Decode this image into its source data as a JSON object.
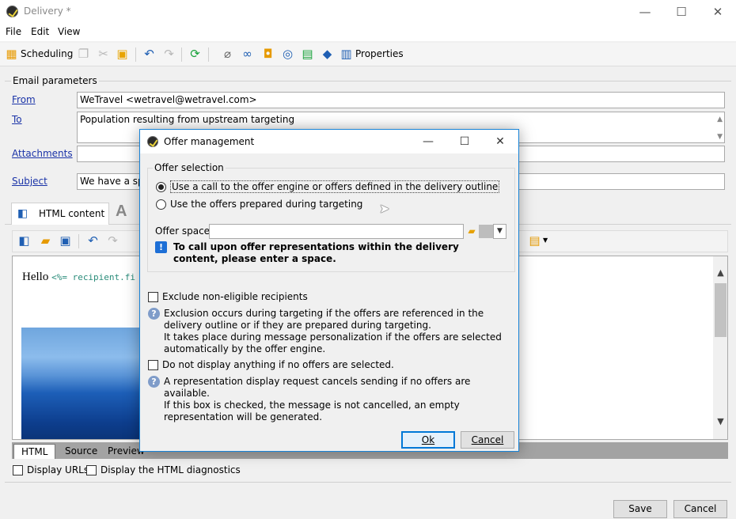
{
  "window": {
    "title": "Delivery *",
    "minimize_glyph": "—",
    "maximize_glyph": "☐",
    "close_glyph": "✕"
  },
  "menu": [
    "File",
    "Edit",
    "View"
  ],
  "toolbar": {
    "scheduling_label": "Scheduling",
    "properties_label": "Properties",
    "icons": [
      "calendar-icon",
      "copy-icon",
      "cut-icon",
      "paste-icon",
      "undo-icon",
      "redo-icon",
      "refresh-icon",
      "attachment-icon",
      "link-icon",
      "gift-icon",
      "target-icon",
      "calculator-icon",
      "tag-icon",
      "clipboard-icon"
    ]
  },
  "email_params": {
    "legend": "Email parameters",
    "from_label": "From",
    "from_value": "WeTravel <wetravel@wetravel.com>",
    "to_label": "To",
    "to_value": "Population resulting from upstream targeting",
    "attachments_label": "Attachments",
    "attachments_value": "",
    "subject_label": "Subject",
    "subject_value": "We have a spe"
  },
  "content_tabs": {
    "html_content": "HTML content",
    "text_tab_glyph": "A"
  },
  "editor": {
    "hello_text": "Hello",
    "hello_code": "<%= recipient.fi"
  },
  "bottom_tabs": [
    "HTML",
    "Source",
    "Preview"
  ],
  "options": {
    "display_urls": "Display URLs",
    "display_html_diagnostics": "Display the HTML diagnostics"
  },
  "footer": {
    "save": "Save",
    "cancel": "Cancel"
  },
  "dialog": {
    "title": "Offer management",
    "offer_selection_legend": "Offer selection",
    "radio_offer_engine": "Use a call to the offer engine or offers defined in the delivery outline",
    "radio_prepared": "Use the offers prepared during targeting",
    "offer_space_label": "Offer space:",
    "offer_space_value": "",
    "offer_space_info": "To call upon offer representations within the delivery content, please enter a space.",
    "exclude_label": "Exclude non-eligible recipients",
    "exclude_help": "Exclusion occurs during targeting if the offers are referenced in the delivery outline or if they are prepared during targeting.\nIt takes place during message personalization if the offers are selected automatically by the offer engine.",
    "no_display_label": "Do not display anything if no offers are selected.",
    "no_display_help": "A representation display request cancels sending if no offers are available.\nIf this box is checked, the message is not cancelled, an empty representation will be generated.",
    "ok": "Ok",
    "cancel": "Cancel"
  },
  "colors": {
    "link": "#1a33a8",
    "dialog_border": "#1883d7",
    "info_blue": "#1d6fd6"
  }
}
